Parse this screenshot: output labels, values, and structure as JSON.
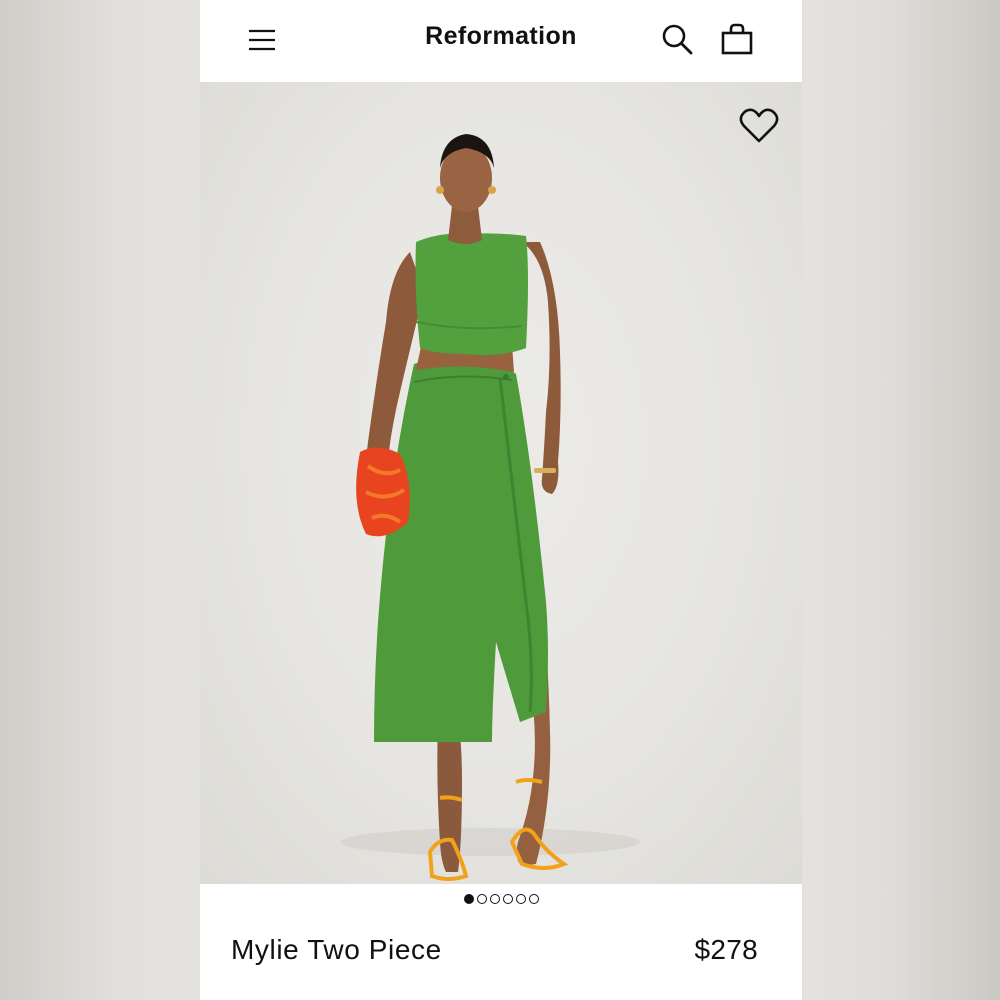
{
  "header": {
    "brand": "Reformation",
    "menu_icon": "hamburger-menu-icon",
    "search_icon": "search-icon",
    "bag_icon": "shopping-bag-icon"
  },
  "gallery": {
    "wishlist_icon": "heart-icon",
    "image_description_icon": "product-photo",
    "dots": [
      true,
      false,
      false,
      false,
      false,
      false
    ]
  },
  "product": {
    "name": "Mylie Two Piece",
    "price": "$278"
  },
  "colors": {
    "garment_green": "#4e9a3a",
    "sandal_orange": "#f2a21a",
    "clutch_red": "#e8431e",
    "background": "#e6e5e1"
  }
}
